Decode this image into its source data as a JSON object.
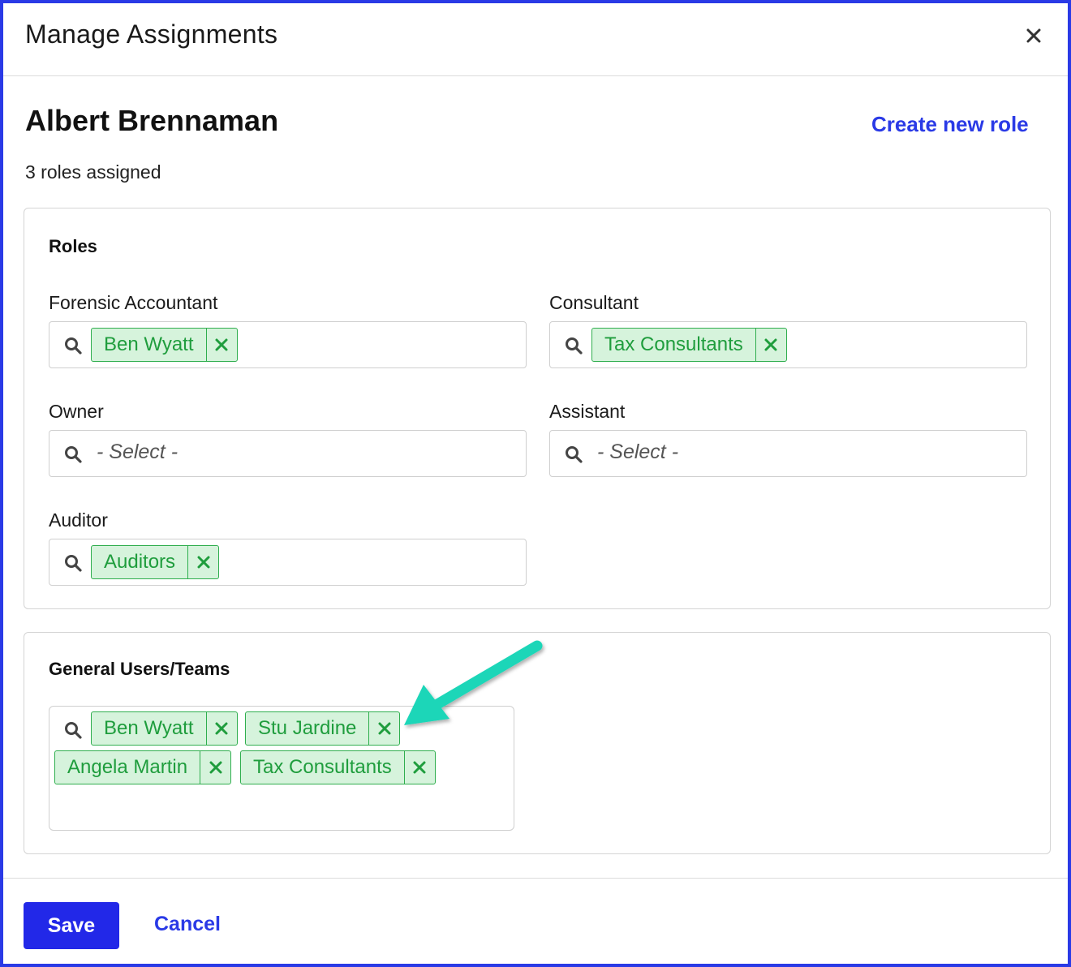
{
  "dialog": {
    "title": "Manage Assignments",
    "close_icon": "close-icon"
  },
  "person": {
    "name": "Albert Brennaman",
    "roles_assigned": "3 roles assigned"
  },
  "actions": {
    "create_role": "Create new role",
    "save": "Save",
    "cancel": "Cancel"
  },
  "roles_panel": {
    "title": "Roles",
    "fields": {
      "forensic_accountant": {
        "label": "Forensic Accountant",
        "chips": [
          "Ben Wyatt"
        ]
      },
      "consultant": {
        "label": "Consultant",
        "chips": [
          "Tax Consultants"
        ]
      },
      "owner": {
        "label": "Owner",
        "placeholder": "- Select -"
      },
      "assistant": {
        "label": "Assistant",
        "placeholder": "- Select -"
      },
      "auditor": {
        "label": "Auditor",
        "chips": [
          "Auditors"
        ]
      }
    }
  },
  "general_panel": {
    "title": "General Users/Teams",
    "chips": [
      "Ben Wyatt",
      "Stu Jardine",
      "Angela Martin",
      "Tax Consultants"
    ]
  },
  "colors": {
    "accent": "#2a3ae6",
    "chip_bg": "#d6f3dc",
    "chip_text": "#1f9d3d",
    "annotation_arrow": "#1fd6b8"
  }
}
